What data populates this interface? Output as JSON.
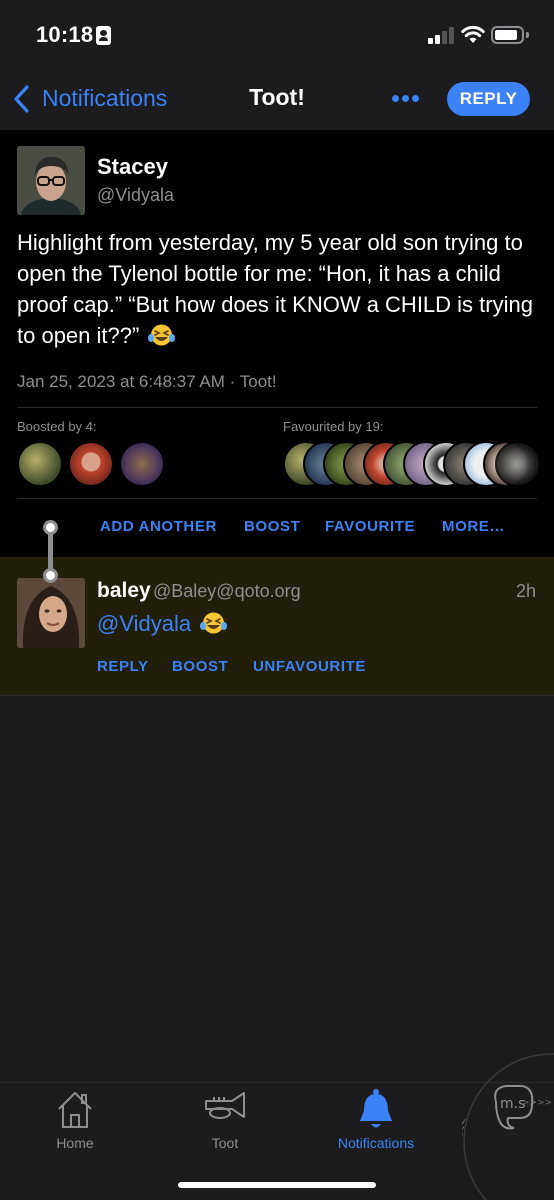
{
  "status_bar": {
    "time": "10:18"
  },
  "nav": {
    "back_label": "Notifications",
    "title": "Toot!",
    "reply_button": "REPLY",
    "more_icon": "ellipsis-icon"
  },
  "main_post": {
    "author_name": "Stacey",
    "author_handle": "@Vidyala",
    "text": "Highlight from yesterday, my 5 year old son trying to open the Tylenol bottle for me: “Hon, it has a child proof cap.” “But how does it KNOW a CHILD is trying to open it??”",
    "emoji": "laughing-tears-emoji",
    "meta": "Jan 25, 2023 at 6:48:37 AM · Toot!",
    "boosted_label": "Boosted by 4:",
    "favourited_label": "Favourited by 19:",
    "actions": {
      "add_another": "ADD ANOTHER",
      "boost": "BOOST",
      "favourite": "FAVOURITE",
      "more": "MORE…"
    }
  },
  "reply_post": {
    "author_name": "baley",
    "author_handle": "@Baley@qoto.org",
    "time": "2h",
    "mention": "@Vidyala",
    "actions": {
      "reply": "REPLY",
      "boost": "BOOST",
      "unfavourite": "UNFAVOURITE"
    }
  },
  "tab_bar": {
    "tabs": [
      {
        "label": "Home",
        "icon": "home-icon",
        "active": false
      },
      {
        "label": "Toot",
        "icon": "trumpet-icon",
        "active": false
      },
      {
        "label": "Notifications",
        "icon": "bell-icon",
        "active": true
      }
    ],
    "widget_text": "m.s"
  },
  "colors": {
    "accent": "#3b82f6",
    "background": "#1c1c1e",
    "post_background": "#000000",
    "reply_highlight": "#211e0b",
    "secondary_text": "#8e8e93"
  }
}
